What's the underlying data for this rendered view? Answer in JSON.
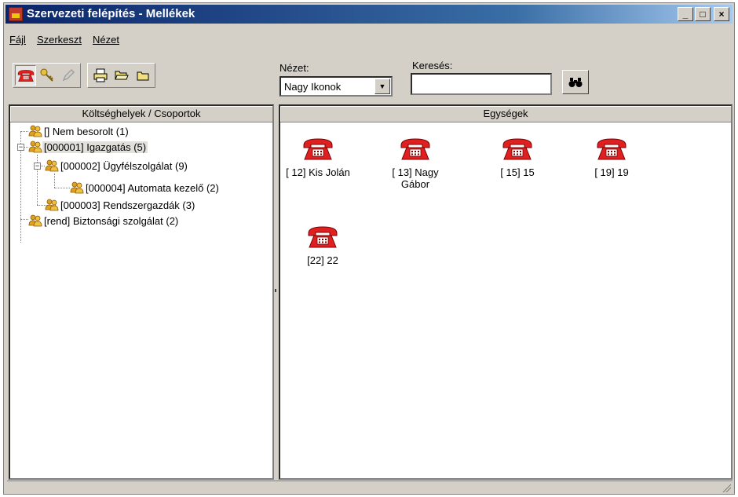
{
  "window": {
    "title": "Szervezeti felépítés - Mellékek"
  },
  "menu": [
    {
      "label": "Fájl"
    },
    {
      "label": "Szerkeszt"
    },
    {
      "label": "Nézet"
    }
  ],
  "toolbar": {
    "group1": [
      "phone-icon",
      "key-icon",
      "pencil-icon"
    ],
    "group2": [
      "print-icon",
      "open-folder-icon",
      "folder-icon"
    ]
  },
  "view": {
    "label": "Nézet:",
    "selected": "Nagy Ikonok"
  },
  "search": {
    "label": "Keresés:",
    "value": ""
  },
  "left_panel": {
    "header": "Költséghelyek / Csoportok"
  },
  "tree": [
    {
      "label": "[] Nem besorolt (1)"
    },
    {
      "label": "[000001] Igazgatás (5)"
    },
    {
      "label": "[000002] Ügyfélszolgálat (9)"
    },
    {
      "label": "[000004] Automata kezelő (2)"
    },
    {
      "label": "[000003] Rendszergazdák (3)"
    },
    {
      "label": "[rend] Biztonsági szolgálat (2)"
    }
  ],
  "right_panel": {
    "header": "Egységek"
  },
  "units": [
    {
      "label": "[ 12] Kis Jolán"
    },
    {
      "label": "[ 13] Nagy Gábor"
    },
    {
      "label": "[ 15] 15"
    },
    {
      "label": "[ 19] 19"
    },
    {
      "label": "[22] 22"
    }
  ],
  "colors": {
    "titlebar": "#0a246a",
    "phone": "#e02020",
    "group_icon": "#e0a020"
  }
}
